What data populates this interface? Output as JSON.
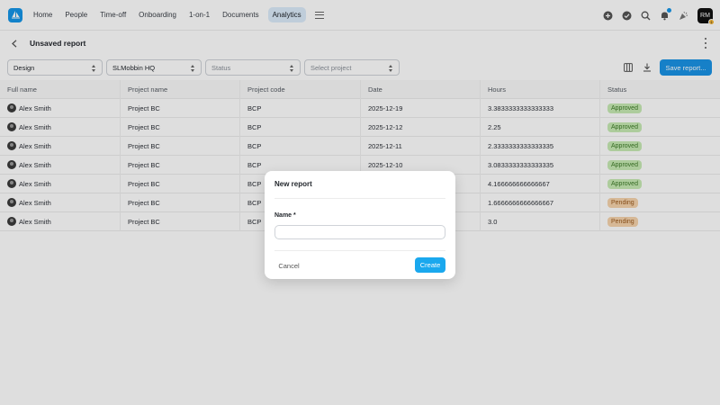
{
  "nav": {
    "items": [
      {
        "label": "Home"
      },
      {
        "label": "People"
      },
      {
        "label": "Time-off"
      },
      {
        "label": "Onboarding"
      },
      {
        "label": "1-on-1"
      },
      {
        "label": "Documents"
      },
      {
        "label": "Analytics",
        "active": true
      }
    ],
    "avatar_initials": "RM",
    "avatar_badge": "1"
  },
  "header": {
    "title": "Unsaved report"
  },
  "filters": {
    "department": "Design",
    "location": "SLMobbin HQ",
    "status_placeholder": "Status",
    "project_placeholder": "Select project",
    "save_label": "Save report..."
  },
  "table": {
    "columns": [
      "Full name",
      "Project name",
      "Project code",
      "Date",
      "Hours",
      "Status"
    ],
    "rows": [
      {
        "name": "Alex Smith",
        "project": "Project BC",
        "code": "BCP",
        "date": "2025-12-19",
        "hours": "3.3833333333333333",
        "status": "Approved"
      },
      {
        "name": "Alex Smith",
        "project": "Project BC",
        "code": "BCP",
        "date": "2025-12-12",
        "hours": "2.25",
        "status": "Approved"
      },
      {
        "name": "Alex Smith",
        "project": "Project BC",
        "code": "BCP",
        "date": "2025-12-11",
        "hours": "2.3333333333333335",
        "status": "Approved"
      },
      {
        "name": "Alex Smith",
        "project": "Project BC",
        "code": "BCP",
        "date": "2025-12-10",
        "hours": "3.0833333333333335",
        "status": "Approved"
      },
      {
        "name": "Alex Smith",
        "project": "Project BC",
        "code": "BCP",
        "date": "",
        "hours": "4.166666666666667",
        "status": "Approved"
      },
      {
        "name": "Alex Smith",
        "project": "Project BC",
        "code": "BCP",
        "date": "",
        "hours": "1.6666666666666667",
        "status": "Pending"
      },
      {
        "name": "Alex Smith",
        "project": "Project BC",
        "code": "BCP",
        "date": "",
        "hours": "3.0",
        "status": "Pending"
      }
    ]
  },
  "status_colors": {
    "Approved": {
      "bg": "#c7ebb4",
      "fg": "#3d7a28"
    },
    "Pending": {
      "bg": "#f6d4ad",
      "fg": "#9a5a1e"
    }
  },
  "modal": {
    "title": "New report",
    "name_label": "Name *",
    "name_value": "",
    "cancel_label": "Cancel",
    "create_label": "Create"
  },
  "colors": {
    "accent": "#1a93e6",
    "create": "#1aa8ee"
  },
  "icons": [
    "logo-icon",
    "menu-icon",
    "plus-circle-icon",
    "check-circle-icon",
    "search-icon",
    "bell-icon",
    "party-popper-icon",
    "back-arrow-icon",
    "more-vertical-icon",
    "columns-icon",
    "download-icon"
  ]
}
